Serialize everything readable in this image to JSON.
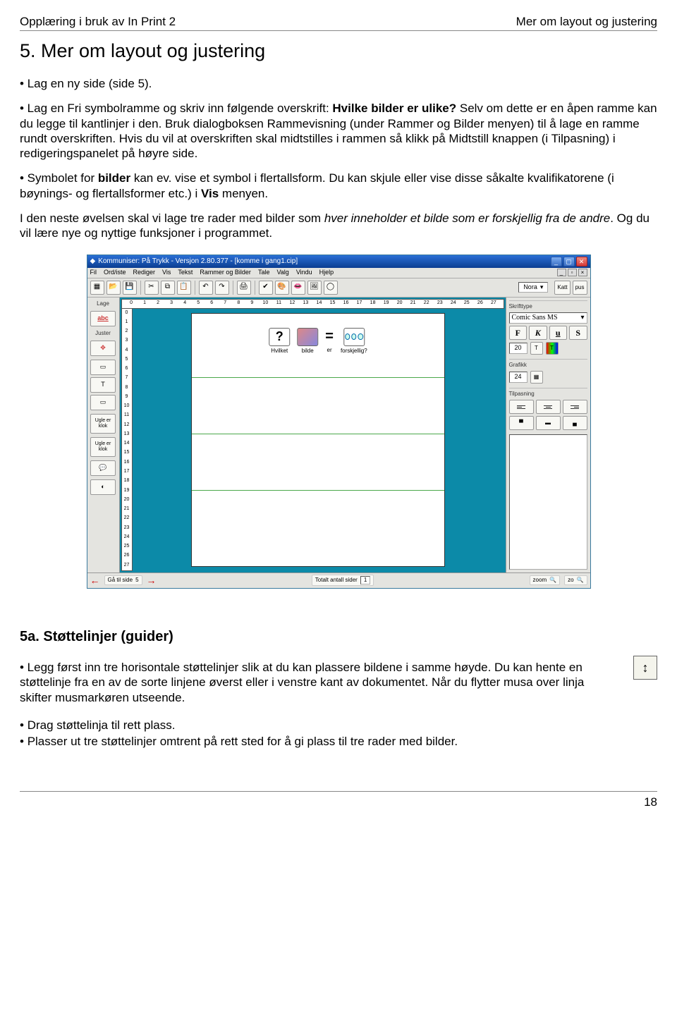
{
  "header": {
    "left": "Opplæring i bruk av In Print 2",
    "right": "Mer om layout og justering"
  },
  "sectionTitle": "5. Mer om layout og justering",
  "bullets1": [
    "Lag en ny side (side 5)."
  ],
  "para1": {
    "prefix": "• Lag en Fri symbolramme og skriv inn følgende overskrift: ",
    "boldPart": "Hvilke bilder er ulike?",
    "rest": " Selv om dette er en åpen ramme kan du legge til kantlinjer i den. Bruk dialogboksen Rammevisning (under Rammer og Bilder menyen) til å lage en ramme rundt overskriften. Hvis du vil at overskriften skal midtstilles i rammen så klikk på Midtstill knappen (i Tilpasning) i redigeringspanelet på høyre side."
  },
  "para2": {
    "prefix": "• Symbolet for ",
    "bold1": "bilder",
    "mid": " kan ev. vise et symbol i flertallsform. Du kan skjule eller vise disse såkalte kvalifikatorene (i bøynings- og flertallsformer etc.) i ",
    "bold2": "Vis",
    "suffix": " menyen."
  },
  "para3": {
    "prefix": "I den neste øvelsen skal vi lage tre rader med bilder som ",
    "italic": "hver inneholder et bilde som er forskjellig fra de andre",
    "suffix": ". Og du vil lære nye og nyttige funksjoner i programmet."
  },
  "subsectionTitle": "5a. Støttelinjer (guider)",
  "para4": "• Legg først inn tre horisontale støttelinjer slik at du kan plassere bildene i samme høyde. Du kan hente en støttelinje fra en av de sorte linjene øverst eller i venstre kant av dokumentet. Når du flytter musa over linja skifter musmarkøren utseende.",
  "bullets2": [
    "Drag støttelinja til rett plass.",
    "Plasser ut tre støttelinjer omtrent på rett sted for å gi plass til tre rader med bilder."
  ],
  "pageNumber": "18",
  "app": {
    "title": "Kommuniser: På Trykk - Versjon 2.80.377 - [komme i gang1.cip]",
    "menus": [
      "Fil",
      "Ord/iste",
      "Rediger",
      "Vis",
      "Tekst",
      "Rammer og Bilder",
      "Tale",
      "Valg",
      "Vindu",
      "Hjelp"
    ],
    "searchValue": "Nora",
    "searchEndLabel1": "Katt",
    "searchEndLabel2": "pus",
    "leftPanel": {
      "topLabel": "Lage",
      "justerLabel": "Juster",
      "buttons": [
        "abc",
        "⇱⇲",
        "□",
        "T",
        "□",
        "Ugle er klok",
        "Ugle er klok",
        "💬",
        "◐"
      ]
    },
    "rulerH": [
      "0",
      "1",
      "2",
      "3",
      "4",
      "5",
      "6",
      "7",
      "8",
      "9",
      "10",
      "11",
      "12",
      "13",
      "14",
      "15",
      "16",
      "17",
      "18",
      "19",
      "20",
      "21",
      "22",
      "23",
      "24",
      "25",
      "26",
      "27"
    ],
    "rulerV": [
      "0",
      "1",
      "2",
      "3",
      "4",
      "5",
      "6",
      "7",
      "8",
      "9",
      "10",
      "11",
      "12",
      "13",
      "14",
      "15",
      "16",
      "17",
      "18",
      "19",
      "20",
      "21",
      "22",
      "23",
      "24",
      "25",
      "26",
      "27"
    ],
    "symbolRow": {
      "labels": [
        "Hvilket",
        "bilde",
        "er",
        "forskjellig?"
      ],
      "eq": "="
    },
    "rightPanel": {
      "fontSectionTitle": "Skrifttype",
      "fontName": "Comic Sans MS",
      "formatButtons": [
        "F",
        "K",
        "u",
        "S"
      ],
      "fontSize": "20",
      "grafikkTitle": "Grafikk",
      "grafikkSize": "24",
      "tilpasningTitle": "Tilpasning"
    },
    "statusbar": {
      "goToSide": "Gå til side",
      "goToSideVal": "5",
      "totalLabel": "Totalt antall sider",
      "totalVal": "1",
      "zoomLabel1": "zoom",
      "zoomLabel2": "zo"
    }
  },
  "resizeGlyph": "↕"
}
